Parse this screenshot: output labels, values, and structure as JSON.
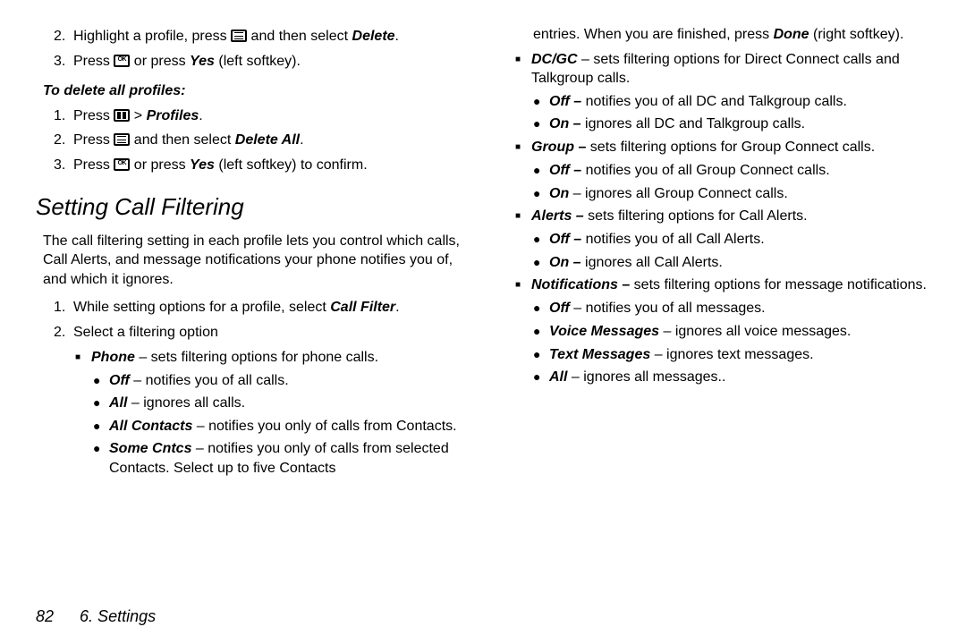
{
  "left": {
    "top_steps": [
      {
        "n": "2.",
        "pre": "Highlight a profile, press ",
        "icon": "menu",
        "post": " and then select ",
        "bi": "Delete",
        "tail": "."
      },
      {
        "n": "3.",
        "pre": "Press ",
        "icon": "ok",
        "post": " or press ",
        "bi": "Yes",
        "tail": " (left softkey)."
      }
    ],
    "delete_all_label": "To delete all profiles:",
    "delete_all_steps": [
      {
        "n": "1.",
        "pre": "Press ",
        "icon": "grid",
        "post": " > ",
        "bi": "Profiles",
        "tail": "."
      },
      {
        "n": "2.",
        "pre": "Press ",
        "icon": "menu",
        "post": " and then select ",
        "bi": "Delete All",
        "tail": "."
      },
      {
        "n": "3.",
        "pre": "Press ",
        "icon": "ok",
        "post": " or press ",
        "bi": "Yes",
        "tail": " (left softkey) to confirm."
      }
    ],
    "heading": "Setting Call Filtering",
    "intro": "The call filtering setting in each profile lets you control which calls, Call Alerts, and message notifications your phone notifies you of, and which it ignores.",
    "filter_steps_1_pre": "While setting options for a profile, select ",
    "filter_steps_1_bi": "Call Filter",
    "filter_steps_1_tail": ".",
    "filter_steps_2": "Select a filtering option",
    "phone_label": "Phone",
    "phone_desc": " – sets filtering options for phone calls.",
    "phone_off_label": "Off",
    "phone_off_desc": " – notifies you of all calls.",
    "phone_all_label": "All",
    "phone_all_desc": " – ignores all calls.",
    "phone_allc_label": "All Contacts",
    "phone_allc_desc": " – notifies you only of calls from Contacts.",
    "phone_some_label": "Some Cntcs",
    "phone_some_desc": " – notifies you only of calls from selected Contacts. Select up to five Contacts"
  },
  "right": {
    "cont_line": "entries. When you are finished, press ",
    "cont_bi": "Done",
    "cont_tail": " (right softkey).",
    "dcgc_label": "DC/GC",
    "dcgc_desc": " – sets filtering options for Direct Connect calls and Talkgroup calls.",
    "dcgc_off_label": "Off –",
    "dcgc_off_desc": " notifies you of all DC and Talkgroup calls.",
    "dcgc_on_label": "On –",
    "dcgc_on_desc": " ignores all DC and Talkgroup calls.",
    "group_label": "Group –",
    "group_desc": " sets filtering options for Group Connect calls.",
    "group_off_label": "Off –",
    "group_off_desc": " notifies you of all Group Connect calls.",
    "group_on_label": "On",
    "group_on_desc": " – ignores all Group Connect calls.",
    "alerts_label": "Alerts –",
    "alerts_desc": " sets filtering options for Call Alerts.",
    "alerts_off_label": "Off –",
    "alerts_off_desc": " notifies you of all Call Alerts.",
    "alerts_on_label": "On –",
    "alerts_on_desc": " ignores all Call Alerts.",
    "notif_label": "Notifications –",
    "notif_desc": " sets filtering options for message notifications.",
    "notif_off_label": "Off",
    "notif_off_desc": " – notifies you of all messages.",
    "notif_vm_label": "Voice Messages",
    "notif_vm_desc": " – ignores all voice messages.",
    "notif_tm_label": "Text Messages",
    "notif_tm_desc": " – ignores text messages.",
    "notif_all_label": "All",
    "notif_all_desc": " – ignores all messages.."
  },
  "footer": {
    "page": "82",
    "section": "6. Settings"
  }
}
